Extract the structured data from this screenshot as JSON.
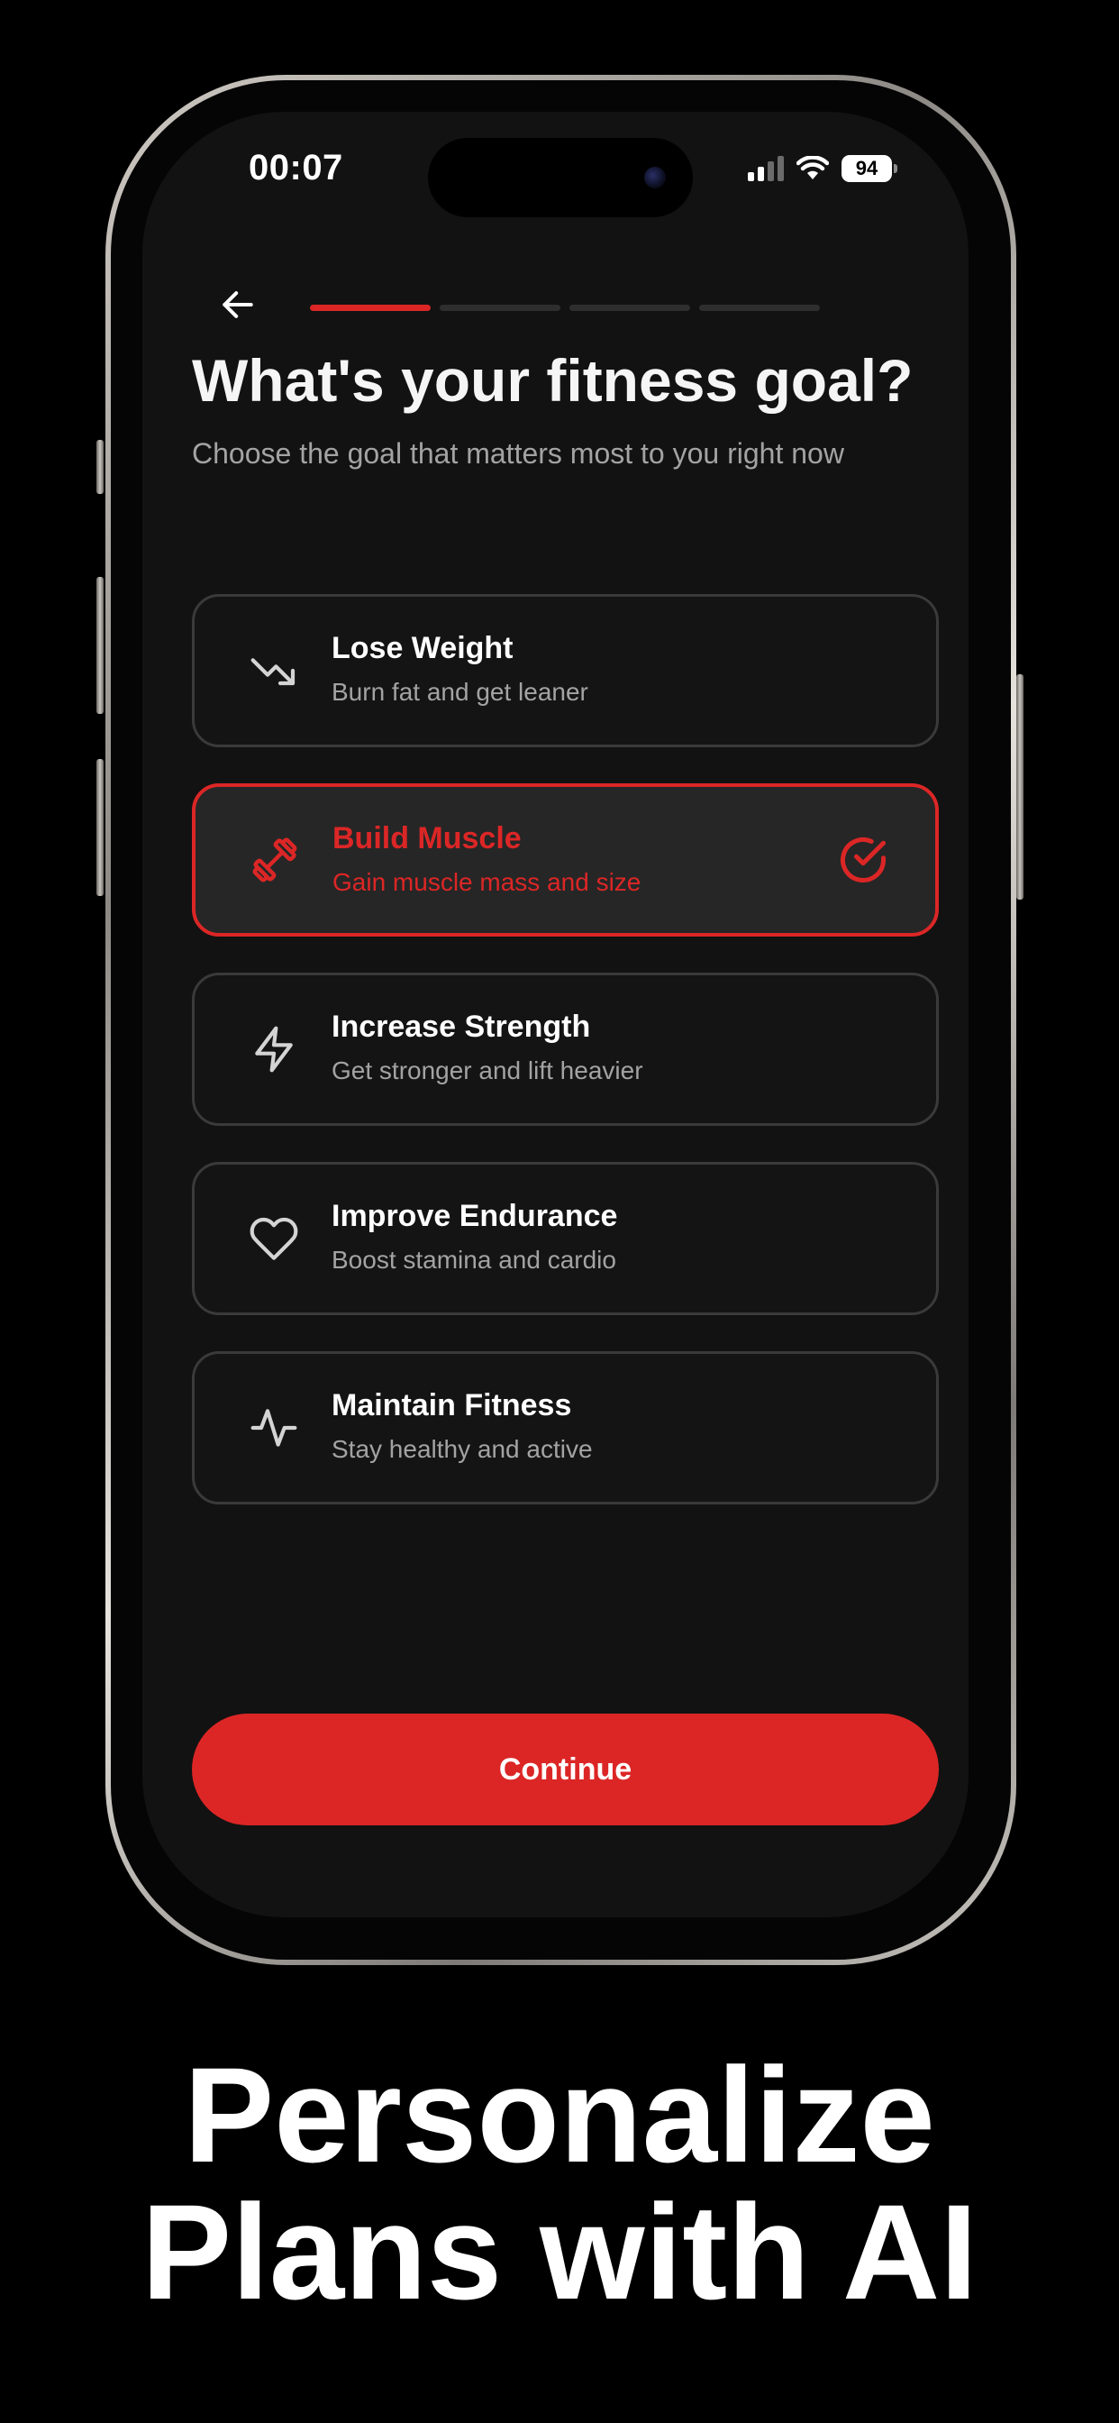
{
  "status_bar": {
    "time": "00:07",
    "battery": "94"
  },
  "header": {
    "back_icon": "arrow-left-icon",
    "progress": {
      "current_step": 1,
      "total_steps": 4
    }
  },
  "screen": {
    "title": "What's your fitness goal?",
    "subtitle": "Choose the goal that matters most to you right now"
  },
  "options": [
    {
      "title": "Lose Weight",
      "description": "Burn fat and get leaner",
      "icon": "trending-down-icon",
      "selected": false
    },
    {
      "title": "Build Muscle",
      "description": "Gain muscle mass and size",
      "icon": "dumbbell-icon",
      "selected": true
    },
    {
      "title": "Increase Strength",
      "description": "Get stronger and lift heavier",
      "icon": "lightning-icon",
      "selected": false
    },
    {
      "title": "Improve Endurance",
      "description": "Boost stamina and cardio",
      "icon": "heart-icon",
      "selected": false
    },
    {
      "title": "Maintain Fitness",
      "description": "Stay healthy and active",
      "icon": "activity-icon",
      "selected": false
    }
  ],
  "continue_label": "Continue",
  "caption": {
    "line1": "Personalize",
    "line2": "Plans with AI"
  },
  "colors": {
    "accent": "#dc2626",
    "background": "#000000",
    "screen": "#121212",
    "card_border": "#3a3a3a",
    "muted_text": "#a3a3a3"
  }
}
